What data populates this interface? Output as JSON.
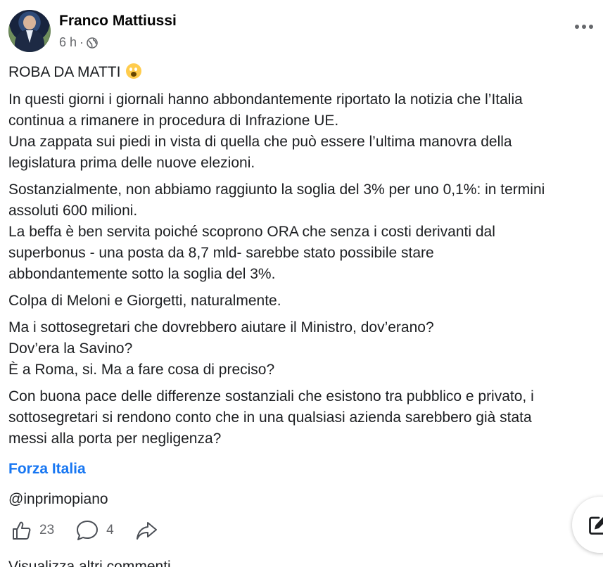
{
  "post": {
    "author": "Franco Mattiussi",
    "time": "6 h",
    "separator": "·",
    "audience_icon": "globe-icon",
    "menu_icon": "more-options-icon",
    "title": "ROBA DA MATTI",
    "title_emoji": "scream-emoji-icon",
    "paragraphs": [
      [
        "In questi giorni i giornali hanno abbondantemente riportato la notizia che l’Italia",
        "continua a rimanere in procedura di Infrazione UE.",
        "Una zappata sui piedi in vista di quella che può essere l’ultima manovra della",
        "legislatura prima delle nuove elezioni."
      ],
      [
        "Sostanzialmente, non abbiamo raggiunto la soglia del 3% per uno 0,1%: in termini",
        "assoluti 600 milioni.",
        "La beffa è ben servita poiché scoprono ORA che senza i costi derivanti dal",
        "superbonus - una posta da 8,7 mld- sarebbe stato possibile stare",
        "abbondantemente sotto la soglia del 3%."
      ],
      [
        "Colpa di Meloni e Giorgetti, naturalmente."
      ],
      [
        "Ma i sottosegretari che dovrebbero aiutare il Ministro, dov’erano?",
        "Dov’era la Savino?",
        "È a Roma, si. Ma a fare cosa di preciso?"
      ],
      [
        "Con buona pace delle differenze sostanziali che esistono tra pubblico e privato, i",
        "sottosegretari si rendono conto che in una qualsiasi azienda sarebbero già stata",
        "messi alla porta per negligenza?"
      ]
    ],
    "page_link": "Forza Italia",
    "mention": "@inprimopiano"
  },
  "actions": {
    "like_count": "23",
    "comment_count": "4",
    "like_icon": "thumbs-up-icon",
    "comment_icon": "comment-bubble-icon",
    "share_icon": "share-arrow-icon"
  },
  "fab": {
    "icon": "compose-edit-icon"
  },
  "footer": {
    "cut_text": "Visualizza altri commenti"
  },
  "colors": {
    "link": "#1877f2",
    "secondary_text": "#65676b",
    "text": "#1c1e21"
  }
}
